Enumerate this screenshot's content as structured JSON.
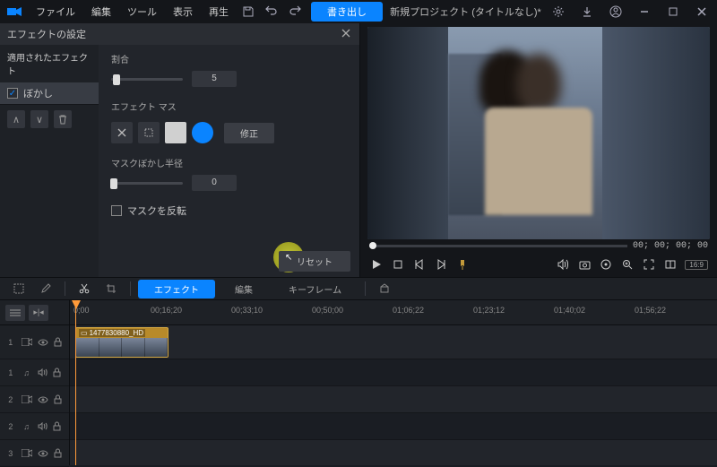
{
  "menubar": {
    "items": [
      "ファイル",
      "編集",
      "ツール",
      "表示",
      "再生"
    ],
    "export_label": "書き出し",
    "project_title": "新規プロジェクト (タイトルなし)*"
  },
  "effect_panel": {
    "title": "エフェクトの設定",
    "list_title": "適用されたエフェクト",
    "items": [
      {
        "label": "ぼかし",
        "checked": true
      }
    ],
    "amount_label": "割合",
    "amount_value": "5",
    "mask_label": "エフェクト マス",
    "modify_label": "修正",
    "radius_label": "マスクぼかし半径",
    "radius_value": "0",
    "invert_label": "マスクを反転",
    "reset_label": "リセット"
  },
  "preview": {
    "timecode": "00; 00; 00; 00",
    "aspect": "16:9"
  },
  "timeline_toolbar": {
    "tabs": [
      "エフェクト",
      "編集",
      "キーフレーム"
    ]
  },
  "ruler": {
    "marks": [
      "0;00",
      "00;16;20",
      "00;33;10",
      "00;50;00",
      "01;06;22",
      "01;23;12",
      "01;40;02",
      "01;56;22"
    ]
  },
  "tracks": {
    "labels": [
      "1",
      "1",
      "2",
      "2",
      "3"
    ]
  },
  "clip": {
    "label": "1477830880_HD"
  }
}
